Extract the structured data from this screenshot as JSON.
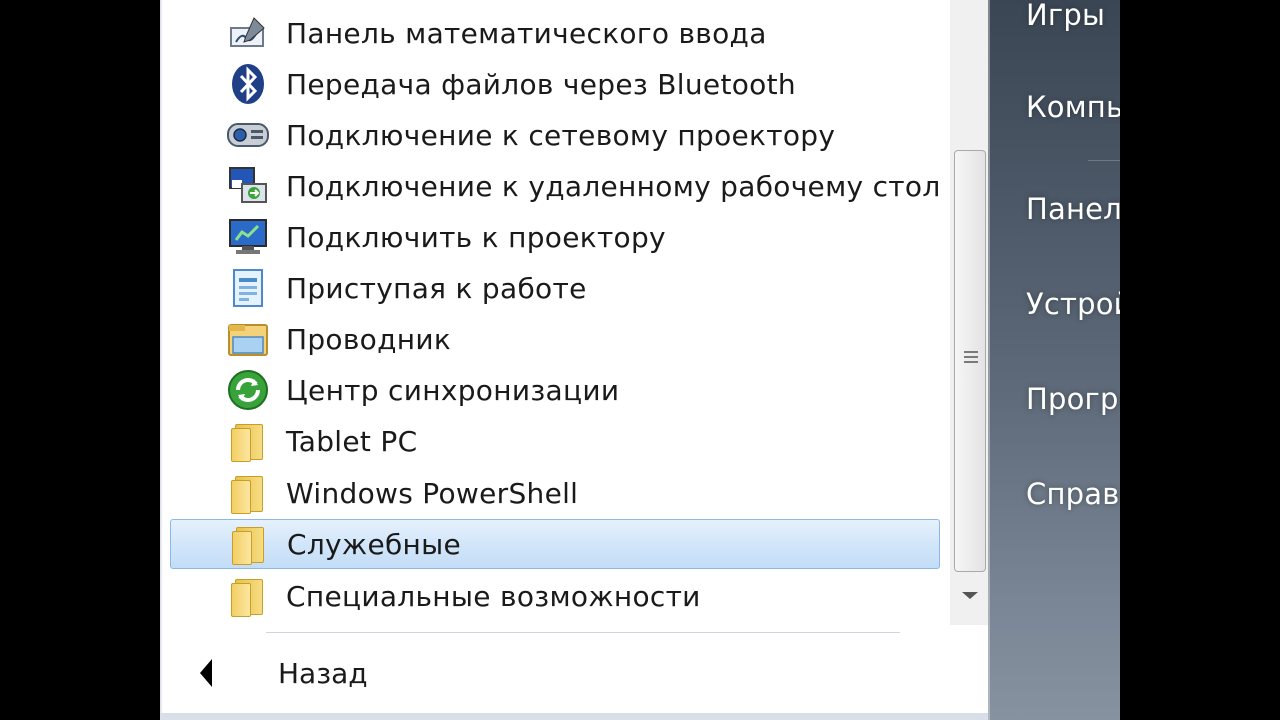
{
  "start_menu": {
    "programs": [
      {
        "label": "Панель математического ввода",
        "icon": "math-input-icon"
      },
      {
        "label": "Передача файлов через Bluetooth",
        "icon": "bluetooth-icon"
      },
      {
        "label": "Подключение к сетевому проектору",
        "icon": "network-projector-icon"
      },
      {
        "label": "Подключение к удаленному рабочему стол",
        "icon": "remote-desktop-icon"
      },
      {
        "label": "Подключить к проектору",
        "icon": "projector-icon"
      },
      {
        "label": "Приступая к работе",
        "icon": "getting-started-icon"
      },
      {
        "label": "Проводник",
        "icon": "explorer-icon"
      },
      {
        "label": "Центр синхронизации",
        "icon": "sync-center-icon"
      },
      {
        "label": "Tablet PC",
        "icon": "folder-icon"
      },
      {
        "label": "Windows PowerShell",
        "icon": "folder-icon"
      },
      {
        "label": "Служебные",
        "icon": "folder-icon",
        "selected": true
      },
      {
        "label": "Специальные возможности",
        "icon": "folder-icon"
      }
    ],
    "back_label": "Назад",
    "right_pane": [
      "Игры",
      "Компь",
      "Панел",
      "Устрой",
      "Прогр",
      "Справ"
    ]
  },
  "colors": {
    "selection": "#cfe4fa",
    "selection_border": "#8ab8e8",
    "right_pane": "#5f6b7a"
  }
}
